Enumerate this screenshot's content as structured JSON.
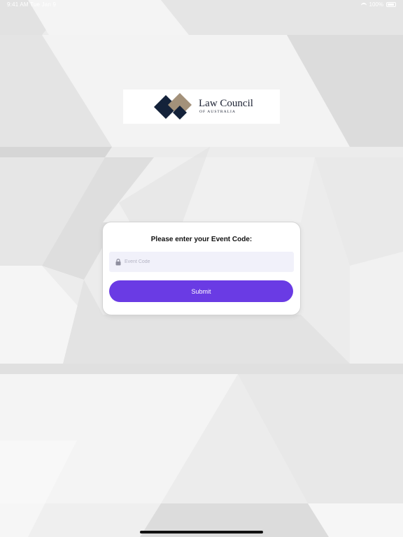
{
  "status_bar": {
    "time": "9:41 AM  Tue Jan 9",
    "battery": "100%"
  },
  "logo": {
    "title": "Law Council",
    "subtitle": "OF AUSTRALIA",
    "colors": {
      "navy": "#14223a",
      "tan": "#a3917a"
    }
  },
  "form": {
    "prompt": "Please enter your Event Code:",
    "input": {
      "placeholder": "Event Code",
      "value": "",
      "icon": "lock-icon"
    },
    "submit_label": "Submit"
  },
  "colors": {
    "accent": "#6a3be4",
    "input_bg": "#f1f1fa",
    "background": "#ececec"
  }
}
